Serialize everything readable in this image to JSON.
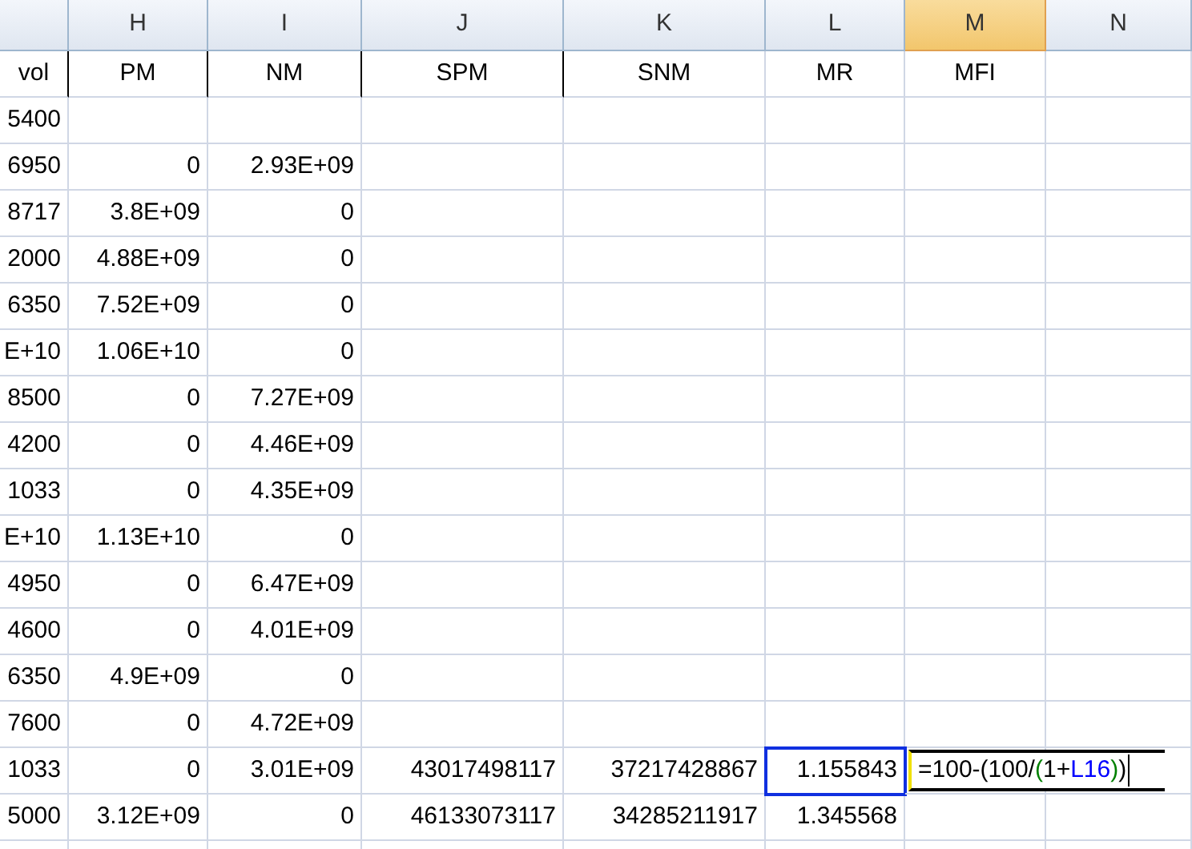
{
  "columns": [
    {
      "letter": "H",
      "selected": false
    },
    {
      "letter": "I",
      "selected": false
    },
    {
      "letter": "J",
      "selected": false
    },
    {
      "letter": "K",
      "selected": false
    },
    {
      "letter": "L",
      "selected": false
    },
    {
      "letter": "M",
      "selected": true
    },
    {
      "letter": "N",
      "selected": false
    }
  ],
  "rows": [
    {
      "kind": "header",
      "selected": false,
      "cells": [
        "vol",
        "PM",
        "NM",
        "SPM",
        "SNM",
        "MR",
        "MFI"
      ]
    },
    {
      "kind": "data",
      "selected": false,
      "cells": [
        "5400"
      ]
    },
    {
      "kind": "data",
      "selected": false,
      "cells": [
        "6950",
        "0",
        "2.93E+09"
      ]
    },
    {
      "kind": "data",
      "selected": false,
      "cells": [
        "8717",
        "3.8E+09",
        "0"
      ]
    },
    {
      "kind": "data",
      "selected": false,
      "cells": [
        "2000",
        "4.88E+09",
        "0"
      ]
    },
    {
      "kind": "data",
      "selected": false,
      "cells": [
        "6350",
        "7.52E+09",
        "0"
      ]
    },
    {
      "kind": "data",
      "selected": false,
      "cells": [
        "E+10",
        "1.06E+10",
        "0"
      ]
    },
    {
      "kind": "data",
      "selected": false,
      "cells": [
        "8500",
        "0",
        "7.27E+09"
      ]
    },
    {
      "kind": "data",
      "selected": false,
      "cells": [
        "4200",
        "0",
        "4.46E+09"
      ]
    },
    {
      "kind": "data",
      "selected": false,
      "cells": [
        "1033",
        "0",
        "4.35E+09"
      ]
    },
    {
      "kind": "data",
      "selected": false,
      "cells": [
        "E+10",
        "1.13E+10",
        "0"
      ]
    },
    {
      "kind": "data",
      "selected": false,
      "cells": [
        "4950",
        "0",
        "6.47E+09"
      ]
    },
    {
      "kind": "data",
      "selected": false,
      "cells": [
        "4600",
        "0",
        "4.01E+09"
      ]
    },
    {
      "kind": "data",
      "selected": false,
      "cells": [
        "6350",
        "4.9E+09",
        "0"
      ]
    },
    {
      "kind": "data",
      "selected": false,
      "cells": [
        "7600",
        "0",
        "4.72E+09"
      ]
    },
    {
      "kind": "data",
      "selected": true,
      "cells": [
        "1033",
        "0",
        "3.01E+09",
        "43017498117",
        "37217428867",
        "1.155843"
      ],
      "formula": [
        {
          "text": "=100-(100/",
          "color": "#000000"
        },
        {
          "text": "(",
          "color": "#008000"
        },
        {
          "text": "1+",
          "color": "#000000"
        },
        {
          "text": "L16",
          "color": "#0000ff"
        },
        {
          "text": ")",
          "color": "#008000"
        },
        {
          "text": ")",
          "color": "#000000"
        }
      ]
    },
    {
      "kind": "data",
      "selected": false,
      "cells": [
        "5000",
        "3.12E+09",
        "0",
        "46133073117",
        "34285211917",
        "1.345568"
      ]
    }
  ]
}
